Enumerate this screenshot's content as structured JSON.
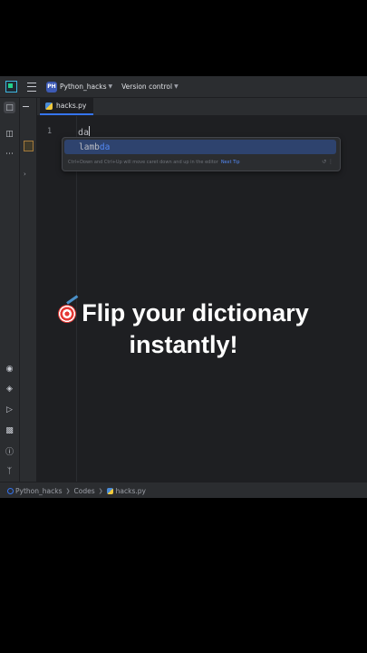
{
  "titlebar": {
    "project_badge": "PH",
    "project_name": "Python_hacks",
    "vcs_label": "Version control"
  },
  "editor": {
    "tab_label": "hacks.py",
    "line_number": "1",
    "code_typed": "da"
  },
  "completion": {
    "prefix": "lamb",
    "match": "da",
    "hint": "Ctrl+Down and Ctrl+Up will move caret down and up in the editor",
    "next_tip": "Next Tip"
  },
  "statusbar": {
    "project": "Python_hacks",
    "folder": "Codes",
    "file": "hacks.py"
  },
  "caption": {
    "line1": "Flip your dictionary",
    "line2": "instantly!"
  },
  "colors": {
    "accent": "#3574f0",
    "editor_bg": "#1e1f22",
    "panel_bg": "#2b2d30"
  }
}
